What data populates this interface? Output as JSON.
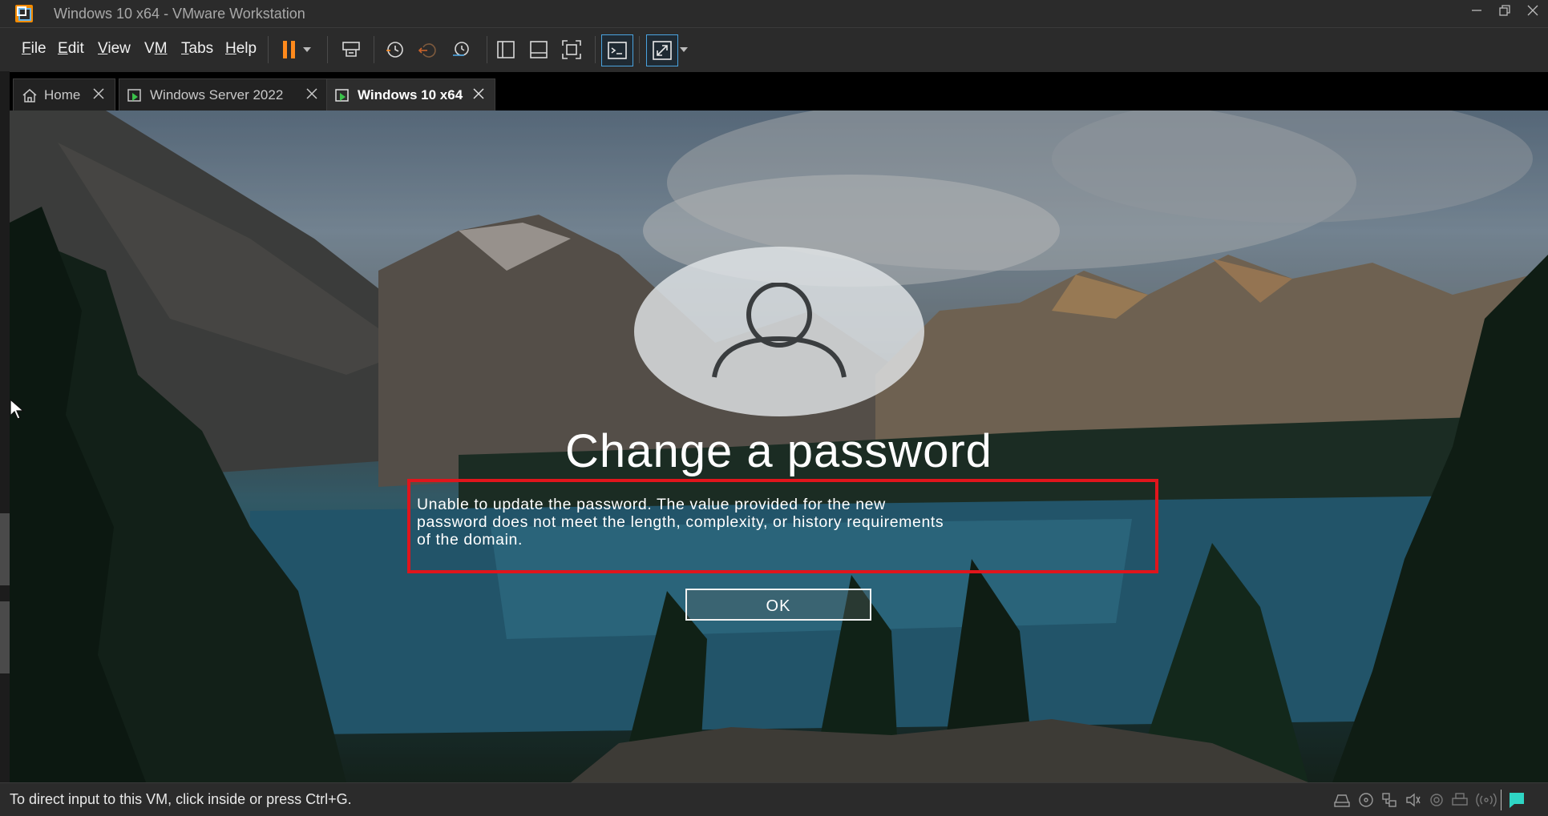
{
  "window": {
    "title": "Windows 10 x64 - VMware Workstation"
  },
  "menu": [
    {
      "pre": "",
      "u": "F",
      "post": "ile"
    },
    {
      "pre": "",
      "u": "E",
      "post": "dit"
    },
    {
      "pre": "",
      "u": "V",
      "post": "iew"
    },
    {
      "pre": "V",
      "u": "M",
      "post": ""
    },
    {
      "pre": "",
      "u": "T",
      "post": "abs"
    },
    {
      "pre": "",
      "u": "H",
      "post": "elp"
    }
  ],
  "tabs": [
    {
      "label": "Home",
      "icon": "home-icon"
    },
    {
      "label": "Windows Server 2022",
      "icon": "vm-icon"
    },
    {
      "label": "Windows 10 x64",
      "icon": "vm-icon",
      "active": true
    }
  ],
  "vm": {
    "heading": "Change a password",
    "error_message": "Unable to update the password. The value provided for the new password does not meet the length, complexity, or history requirements of the domain.",
    "error_lines": [
      "Unable to update the password. The value provided for the new",
      "password does not meet the length, complexity, or history requirements",
      "of the domain."
    ],
    "ok_label": "OK"
  },
  "status": {
    "text": "To direct input to this VM, click inside or press Ctrl+G."
  },
  "colors": {
    "accent": "#ff8a1c",
    "highlight_border": "#e0151c",
    "chrome": "#2b2b2b"
  }
}
